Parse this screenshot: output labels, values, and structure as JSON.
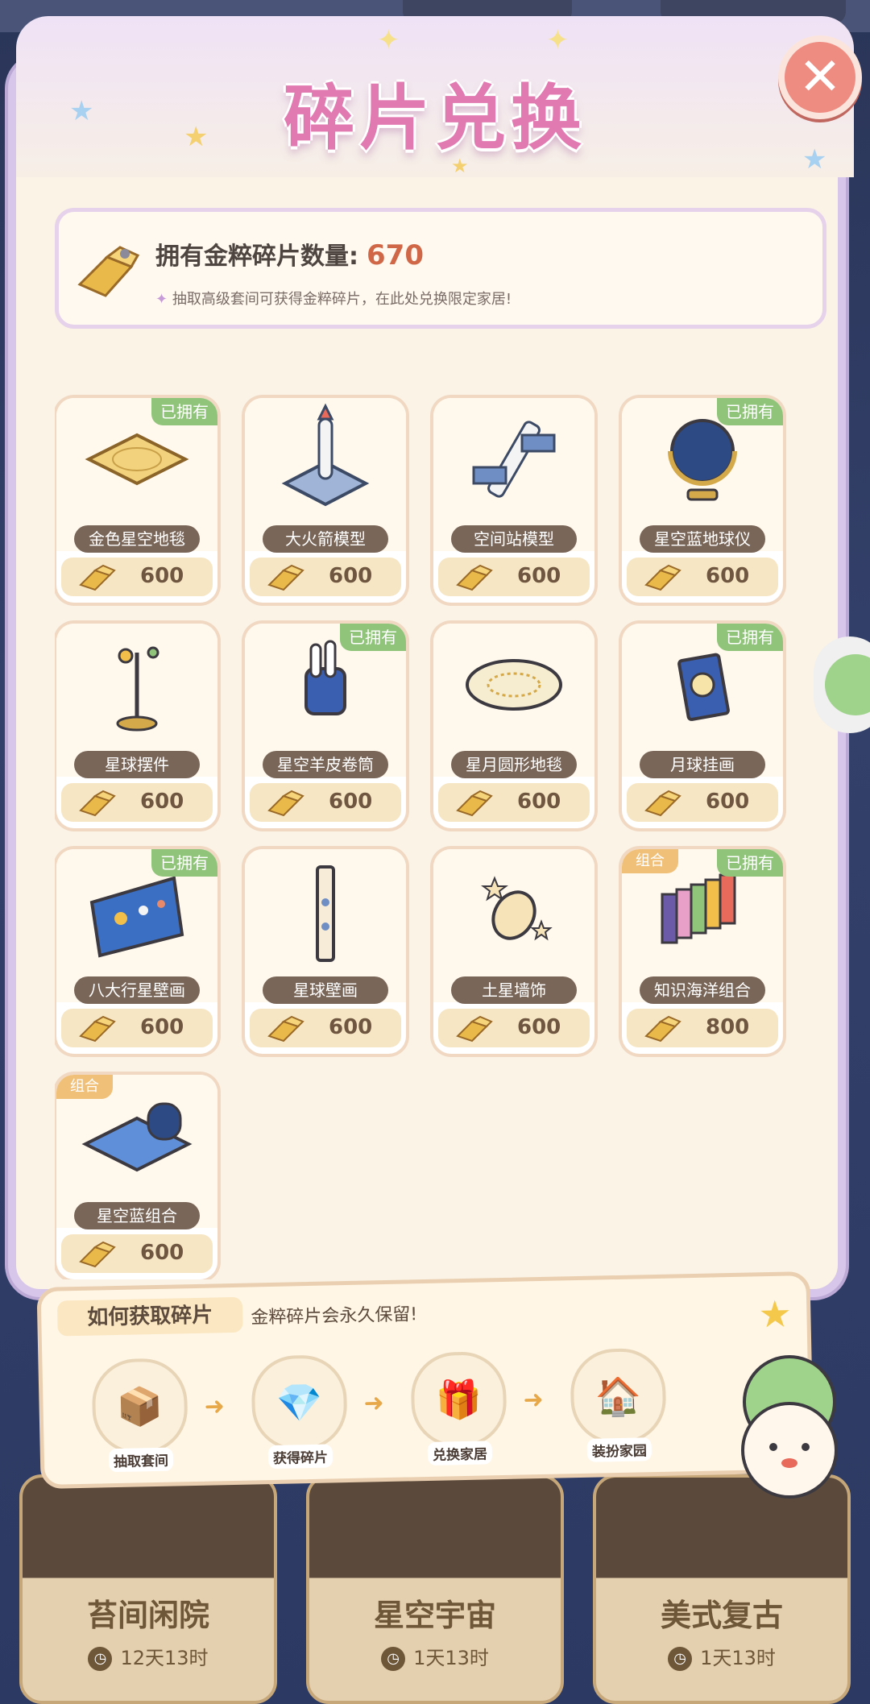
{
  "title": "碎片兑换",
  "info": {
    "label": "拥有金粹碎片数量:",
    "count": "670",
    "note": "抽取高级套间可获得金粹碎片，在此处兑换限定家居!"
  },
  "items": [
    {
      "name": "金色星空地毯",
      "price": "600",
      "owned": "已拥有",
      "combo": "",
      "icon": "gold-star-carpet-icon"
    },
    {
      "name": "大火箭模型",
      "price": "600",
      "owned": "",
      "combo": "",
      "icon": "rocket-model-icon"
    },
    {
      "name": "空间站模型",
      "price": "600",
      "owned": "",
      "combo": "",
      "icon": "space-station-icon"
    },
    {
      "name": "星空蓝地球仪",
      "price": "600",
      "owned": "已拥有",
      "combo": "",
      "icon": "globe-icon"
    },
    {
      "name": "星球摆件",
      "price": "600",
      "owned": "",
      "combo": "",
      "icon": "planet-ornament-icon"
    },
    {
      "name": "星空羊皮卷筒",
      "price": "600",
      "owned": "已拥有",
      "combo": "",
      "icon": "scroll-holder-icon"
    },
    {
      "name": "星月圆形地毯",
      "price": "600",
      "owned": "",
      "combo": "",
      "icon": "round-carpet-icon"
    },
    {
      "name": "月球挂画",
      "price": "600",
      "owned": "已拥有",
      "combo": "",
      "icon": "moon-painting-icon"
    },
    {
      "name": "八大行星壁画",
      "price": "600",
      "owned": "已拥有",
      "combo": "",
      "icon": "planets-mural-icon"
    },
    {
      "name": "星球壁画",
      "price": "600",
      "owned": "",
      "combo": "",
      "icon": "planet-mural-icon"
    },
    {
      "name": "土星墙饰",
      "price": "600",
      "owned": "",
      "combo": "",
      "icon": "saturn-wall-icon"
    },
    {
      "name": "知识海洋组合",
      "price": "800",
      "owned": "已拥有",
      "combo": "组合",
      "icon": "books-set-icon"
    },
    {
      "name": "星空蓝组合",
      "price": "600",
      "owned": "",
      "combo": "组合",
      "icon": "blue-sky-set-icon"
    }
  ],
  "top_partial_prices": [
    "600",
    "600",
    "600",
    "600"
  ],
  "help": {
    "title": "如何获取碎片",
    "note": "金粹碎片会永久保留!",
    "steps": [
      "抽取套间",
      "获得碎片",
      "兑换家居",
      "装扮家园"
    ]
  },
  "themes": [
    {
      "name": "苔间闲院",
      "time": "12天13时"
    },
    {
      "name": "星空宇宙",
      "time": "1天13时"
    },
    {
      "name": "美式复古",
      "time": "1天13时"
    }
  ],
  "colors": {
    "accent": "#e07ab0",
    "owned": "#8fc47a",
    "combo": "#f1c078",
    "close": "#ee8c82"
  }
}
